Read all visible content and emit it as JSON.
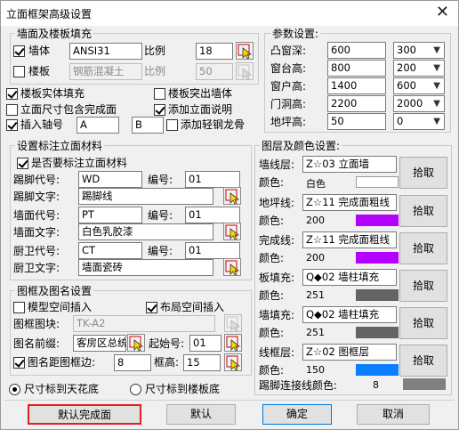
{
  "window": {
    "title": "立面框架高级设置",
    "close": "✕"
  },
  "wall_slab": {
    "group_title": "墙面及楼板填充",
    "wall_label": "墙体",
    "wall_checked": true,
    "wall_pattern": "ANSI31",
    "wall_scale_label": "比例",
    "wall_scale": "18",
    "slab_label": "楼板",
    "slab_checked": false,
    "slab_pattern": "钢筋混凝土",
    "slab_scale_label": "比例",
    "slab_scale": "50"
  },
  "options": {
    "slab_solid_fill": "楼板实体填充",
    "slab_protrude_wall": "楼板突出墙体",
    "size_includes_finish": "立面尺寸包含完成面",
    "add_elevation_note": "添加立面说明",
    "insert_axis": "插入轴号",
    "axis_a": "A",
    "axis_b": "B",
    "add_light_keel": "添加轻钢龙骨"
  },
  "material": {
    "group_title": "设置标注立面材料",
    "need_label": "是否要标注立面材料",
    "skirting_code_label": "踢脚代号:",
    "skirting_code": "WD",
    "skirting_no_label": "编号:",
    "skirting_no": "01",
    "skirting_text_label": "踢脚文字:",
    "skirting_text": "踢脚线",
    "wall_code_label": "墙面代号:",
    "wall_code": "PT",
    "wall_no_label": "编号:",
    "wall_no": "01",
    "wall_text_label": "墙面文字:",
    "wall_text": "白色乳胶漆",
    "kitchen_code_label": "厨卫代号:",
    "kitchen_code": "CT",
    "kitchen_no_label": "编号:",
    "kitchen_no": "01",
    "kitchen_text_label": "厨卫文字:",
    "kitchen_text": "墙面瓷砖"
  },
  "frame": {
    "group_title": "图框及图名设置",
    "model_space": "模型空间插入",
    "layout_space": "布局空间插入",
    "block_label": "图框图块:",
    "block_value": "TK-A2",
    "prefix_label": "图名前缀:",
    "prefix_value": "客房区总统",
    "start_no_label": "起始号:",
    "start_no": "01",
    "distance_label": "图名距图框边:",
    "distance": "8",
    "height_label": "框高:",
    "height": "15"
  },
  "params": {
    "group_title": "参数设置:",
    "rows": [
      {
        "label": "凸窗深:",
        "value": "600",
        "select": "300"
      },
      {
        "label": "窗台高:",
        "value": "800",
        "select": "200"
      },
      {
        "label": "窗户高:",
        "value": "1400",
        "select": "600"
      },
      {
        "label": "门洞高:",
        "value": "2200",
        "select": "2000"
      },
      {
        "label": "地坪高:",
        "value": "50",
        "select": "0"
      }
    ]
  },
  "layers": {
    "group_title": "图层及颜色设置:",
    "color_label": "颜色:",
    "pick_label": "拾取",
    "items": [
      {
        "label": "墙线层:",
        "value": "Z☆03 立面墙",
        "color_text": "白色",
        "color_hex": "#ffffff"
      },
      {
        "label": "地坪线:",
        "value": "Z☆11 完成面粗线",
        "color_text": "200",
        "color_hex": "#b400ff"
      },
      {
        "label": "完成线:",
        "value": "Z☆11 完成面粗线",
        "color_text": "200",
        "color_hex": "#b400ff"
      },
      {
        "label": "板填充:",
        "value": "Q◆02 墙柱填充",
        "color_text": "251",
        "color_hex": "#646464"
      },
      {
        "label": "墙填充:",
        "value": "Q◆02 墙柱填充",
        "color_text": "251",
        "color_hex": "#646464"
      },
      {
        "label": "线框层:",
        "value": "Z☆02 图框层",
        "color_text": "150",
        "color_hex": "#0a7fff"
      }
    ],
    "skirting_color_label": "踢脚连接线颜色:",
    "skirting_color_value": "8",
    "skirting_color_hex": "#808080"
  },
  "dims": {
    "to_ceiling": "尺寸标到天花底",
    "to_ceiling_checked": true,
    "to_slab": "尺寸标到楼板底",
    "to_slab_checked": false
  },
  "buttons": {
    "default_finish": "默认完成面",
    "default": "默认",
    "ok": "确定",
    "cancel": "取消"
  }
}
